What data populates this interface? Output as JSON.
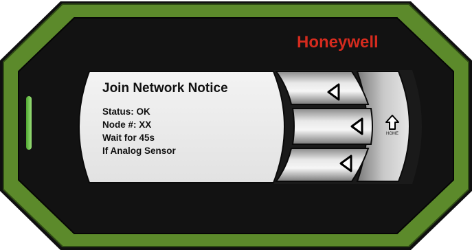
{
  "brand": {
    "name": "Honeywell",
    "color": "#d52b1e"
  },
  "display": {
    "title": "Join Network Notice",
    "lines": [
      "Status: OK",
      "Node #: XX",
      "Wait for 45s",
      "If Analog Sensor"
    ]
  },
  "controls": {
    "home_label": "HOME",
    "buttons": [
      {
        "name": "up-left-button",
        "icon": "left-triangle-icon"
      },
      {
        "name": "middle-left-button",
        "icon": "left-triangle-icon"
      },
      {
        "name": "down-left-button",
        "icon": "left-triangle-icon"
      },
      {
        "name": "home-button",
        "icon": "home-arrow-icon"
      }
    ]
  },
  "colors": {
    "housing_green": "#5a8a2a",
    "bezel_black": "#111111",
    "screen": "#eeeeee",
    "status_led": "#6fc24a"
  }
}
